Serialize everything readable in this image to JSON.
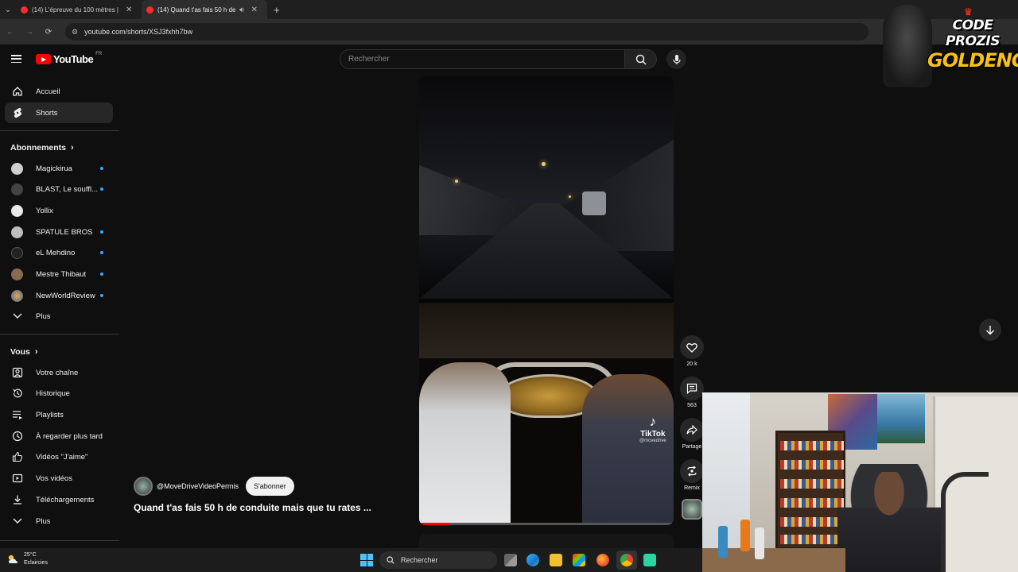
{
  "browser": {
    "tabs": [
      {
        "title": "(14) L'épreuve du 100 mètres |",
        "active": false
      },
      {
        "title": "(14) Quand t'as fais 50 h de",
        "active": true,
        "audio": true
      }
    ],
    "url": "youtube.com/shorts/XSJ3fxhh7bw"
  },
  "youtube": {
    "logo_text": "YouTube",
    "country_code": "FR",
    "search_placeholder": "Rechercher"
  },
  "sidebar": {
    "main": [
      {
        "label": "Accueil",
        "icon": "home-icon"
      },
      {
        "label": "Shorts",
        "icon": "shorts-icon",
        "selected": true
      }
    ],
    "subscriptions_title": "Abonnements",
    "subscriptions": [
      {
        "label": "Magickirua",
        "new": true,
        "color": "#cfcfcf"
      },
      {
        "label": "BLAST, Le souffl...",
        "new": true,
        "color": "#444444"
      },
      {
        "label": "Yollix",
        "new": false,
        "color": "#e8e8e8"
      },
      {
        "label": "SPATULE BROS",
        "new": true,
        "color": "#bdbdbd"
      },
      {
        "label": "eL Mehdino",
        "new": true,
        "color": "#222222"
      },
      {
        "label": "Mestre Thibaut",
        "new": true,
        "color": "#8a6a4e"
      },
      {
        "label": "NewWorldReview",
        "new": true,
        "color": "#e06a2a"
      }
    ],
    "subs_more": "Plus",
    "you_title": "Vous",
    "you": [
      {
        "label": "Votre chaîne",
        "icon": "channel-icon"
      },
      {
        "label": "Historique",
        "icon": "history-icon"
      },
      {
        "label": "Playlists",
        "icon": "playlists-icon"
      },
      {
        "label": "À regarder plus tard",
        "icon": "watch-later-icon"
      },
      {
        "label": "Vidéos \"J'aime\"",
        "icon": "like-icon"
      },
      {
        "label": "Vos vidéos",
        "icon": "your-videos-icon"
      },
      {
        "label": "Téléchargements",
        "icon": "download-icon"
      }
    ],
    "you_more": "Plus"
  },
  "short": {
    "channel": "@MoveDriveVideoPermis",
    "subscribe_label": "S'abonner",
    "title": "Quand t'as fais 50 h de conduite mais que tu rates ...",
    "watermark": "TikTok",
    "watermark_handle": "@movedrive",
    "progress": 0.12,
    "actions": {
      "likes": "20 k",
      "comments": "563",
      "share": "Partage",
      "remix": "Remix"
    }
  },
  "overlay_logo": {
    "line1": "CODE PROZIS",
    "line2": "GOLDENG"
  },
  "taskbar": {
    "temperature": "25°C",
    "weather": "Eclaircies",
    "search_placeholder": "Rechercher"
  }
}
